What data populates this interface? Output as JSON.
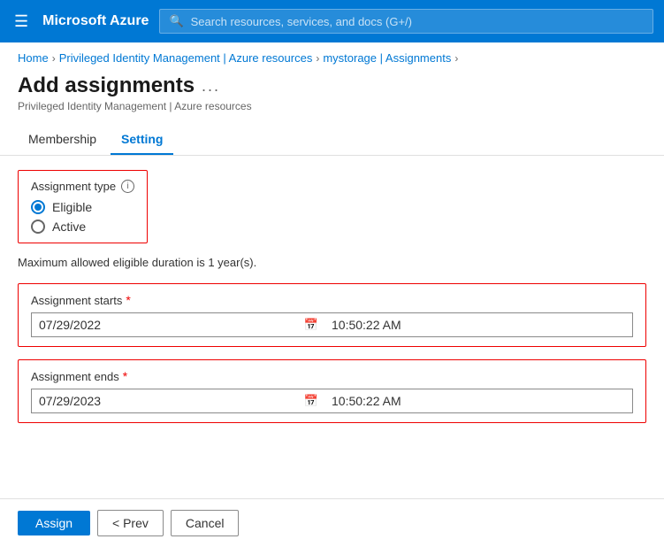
{
  "topbar": {
    "logo": "Microsoft Azure",
    "search_placeholder": "Search resources, services, and docs (G+/)"
  },
  "breadcrumb": {
    "home": "Home",
    "pim": "Privileged Identity Management | Azure resources",
    "storage": "mystorage | Assignments"
  },
  "page": {
    "title": "Add assignments",
    "subtitle": "Privileged Identity Management | Azure resources",
    "ellipsis": "..."
  },
  "tabs": [
    {
      "label": "Membership",
      "active": false
    },
    {
      "label": "Setting",
      "active": true
    }
  ],
  "assignment_type": {
    "label": "Assignment type",
    "options": [
      {
        "label": "Eligible",
        "checked": true
      },
      {
        "label": "Active",
        "checked": false
      }
    ]
  },
  "notice": "Maximum allowed eligible duration is 1 year(s).",
  "assignment_starts": {
    "label": "Assignment starts",
    "date_value": "07/29/2022",
    "time_value": "10:50:22 AM"
  },
  "assignment_ends": {
    "label": "Assignment ends",
    "date_value": "07/29/2023",
    "time_value": "10:50:22 AM"
  },
  "footer": {
    "assign_label": "Assign",
    "prev_label": "< Prev",
    "cancel_label": "Cancel"
  }
}
